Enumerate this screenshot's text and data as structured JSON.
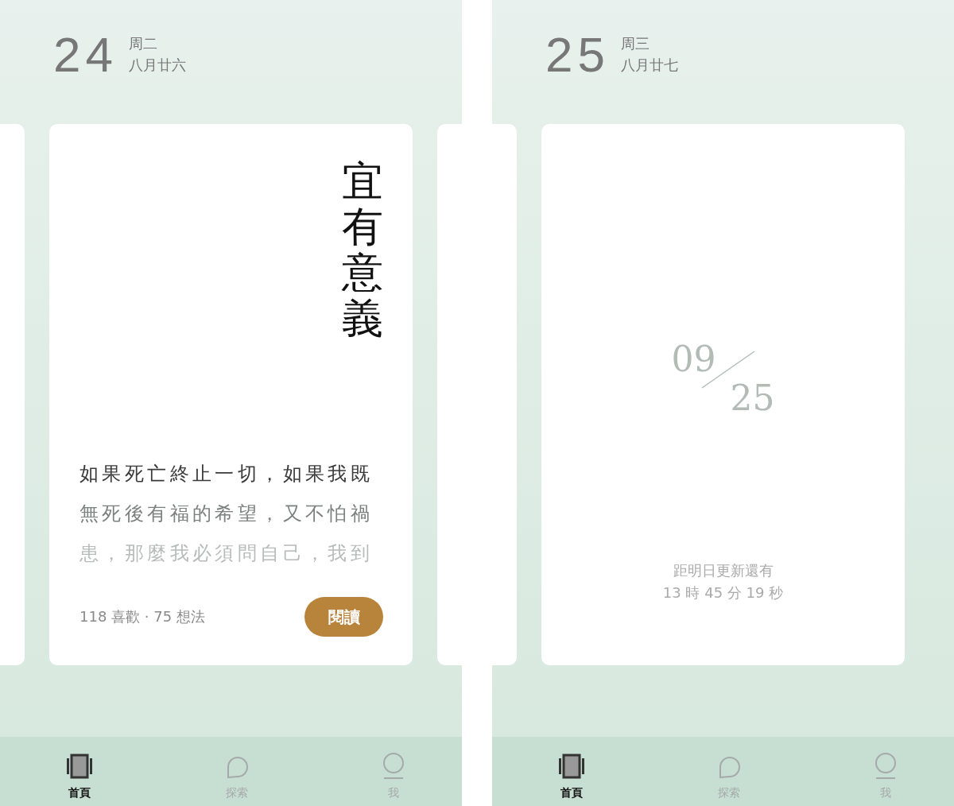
{
  "screens": [
    {
      "date": {
        "day": "24",
        "weekday": "周二",
        "lunar": "八月廿六"
      },
      "prev_card": true,
      "next_card": true,
      "card": {
        "kind": "quote",
        "title": "宜有意義",
        "lines": [
          "如果死亡終止一切，如果我既",
          "無死後有福的希望，又不怕禍",
          "患，那麼我必須問自己，我到"
        ],
        "stats": "118 喜歡 · 75 想法",
        "button": "閱讀"
      },
      "nav": [
        {
          "label": "首頁",
          "kind": "home",
          "selected": true
        },
        {
          "label": "探索",
          "kind": "explore",
          "selected": false
        },
        {
          "label": "我",
          "kind": "me",
          "selected": false
        }
      ]
    },
    {
      "date": {
        "day": "25",
        "weekday": "周三",
        "lunar": "八月廿七"
      },
      "prev_card": true,
      "next_card": false,
      "card": {
        "kind": "countdown",
        "month": "09",
        "day": "25",
        "caption": "距明日更新還有",
        "countdown": "13 時 45 分 19 秒"
      },
      "nav": [
        {
          "label": "首頁",
          "kind": "home",
          "selected": true
        },
        {
          "label": "探索",
          "kind": "explore",
          "selected": false
        },
        {
          "label": "我",
          "kind": "me",
          "selected": false
        }
      ]
    }
  ]
}
